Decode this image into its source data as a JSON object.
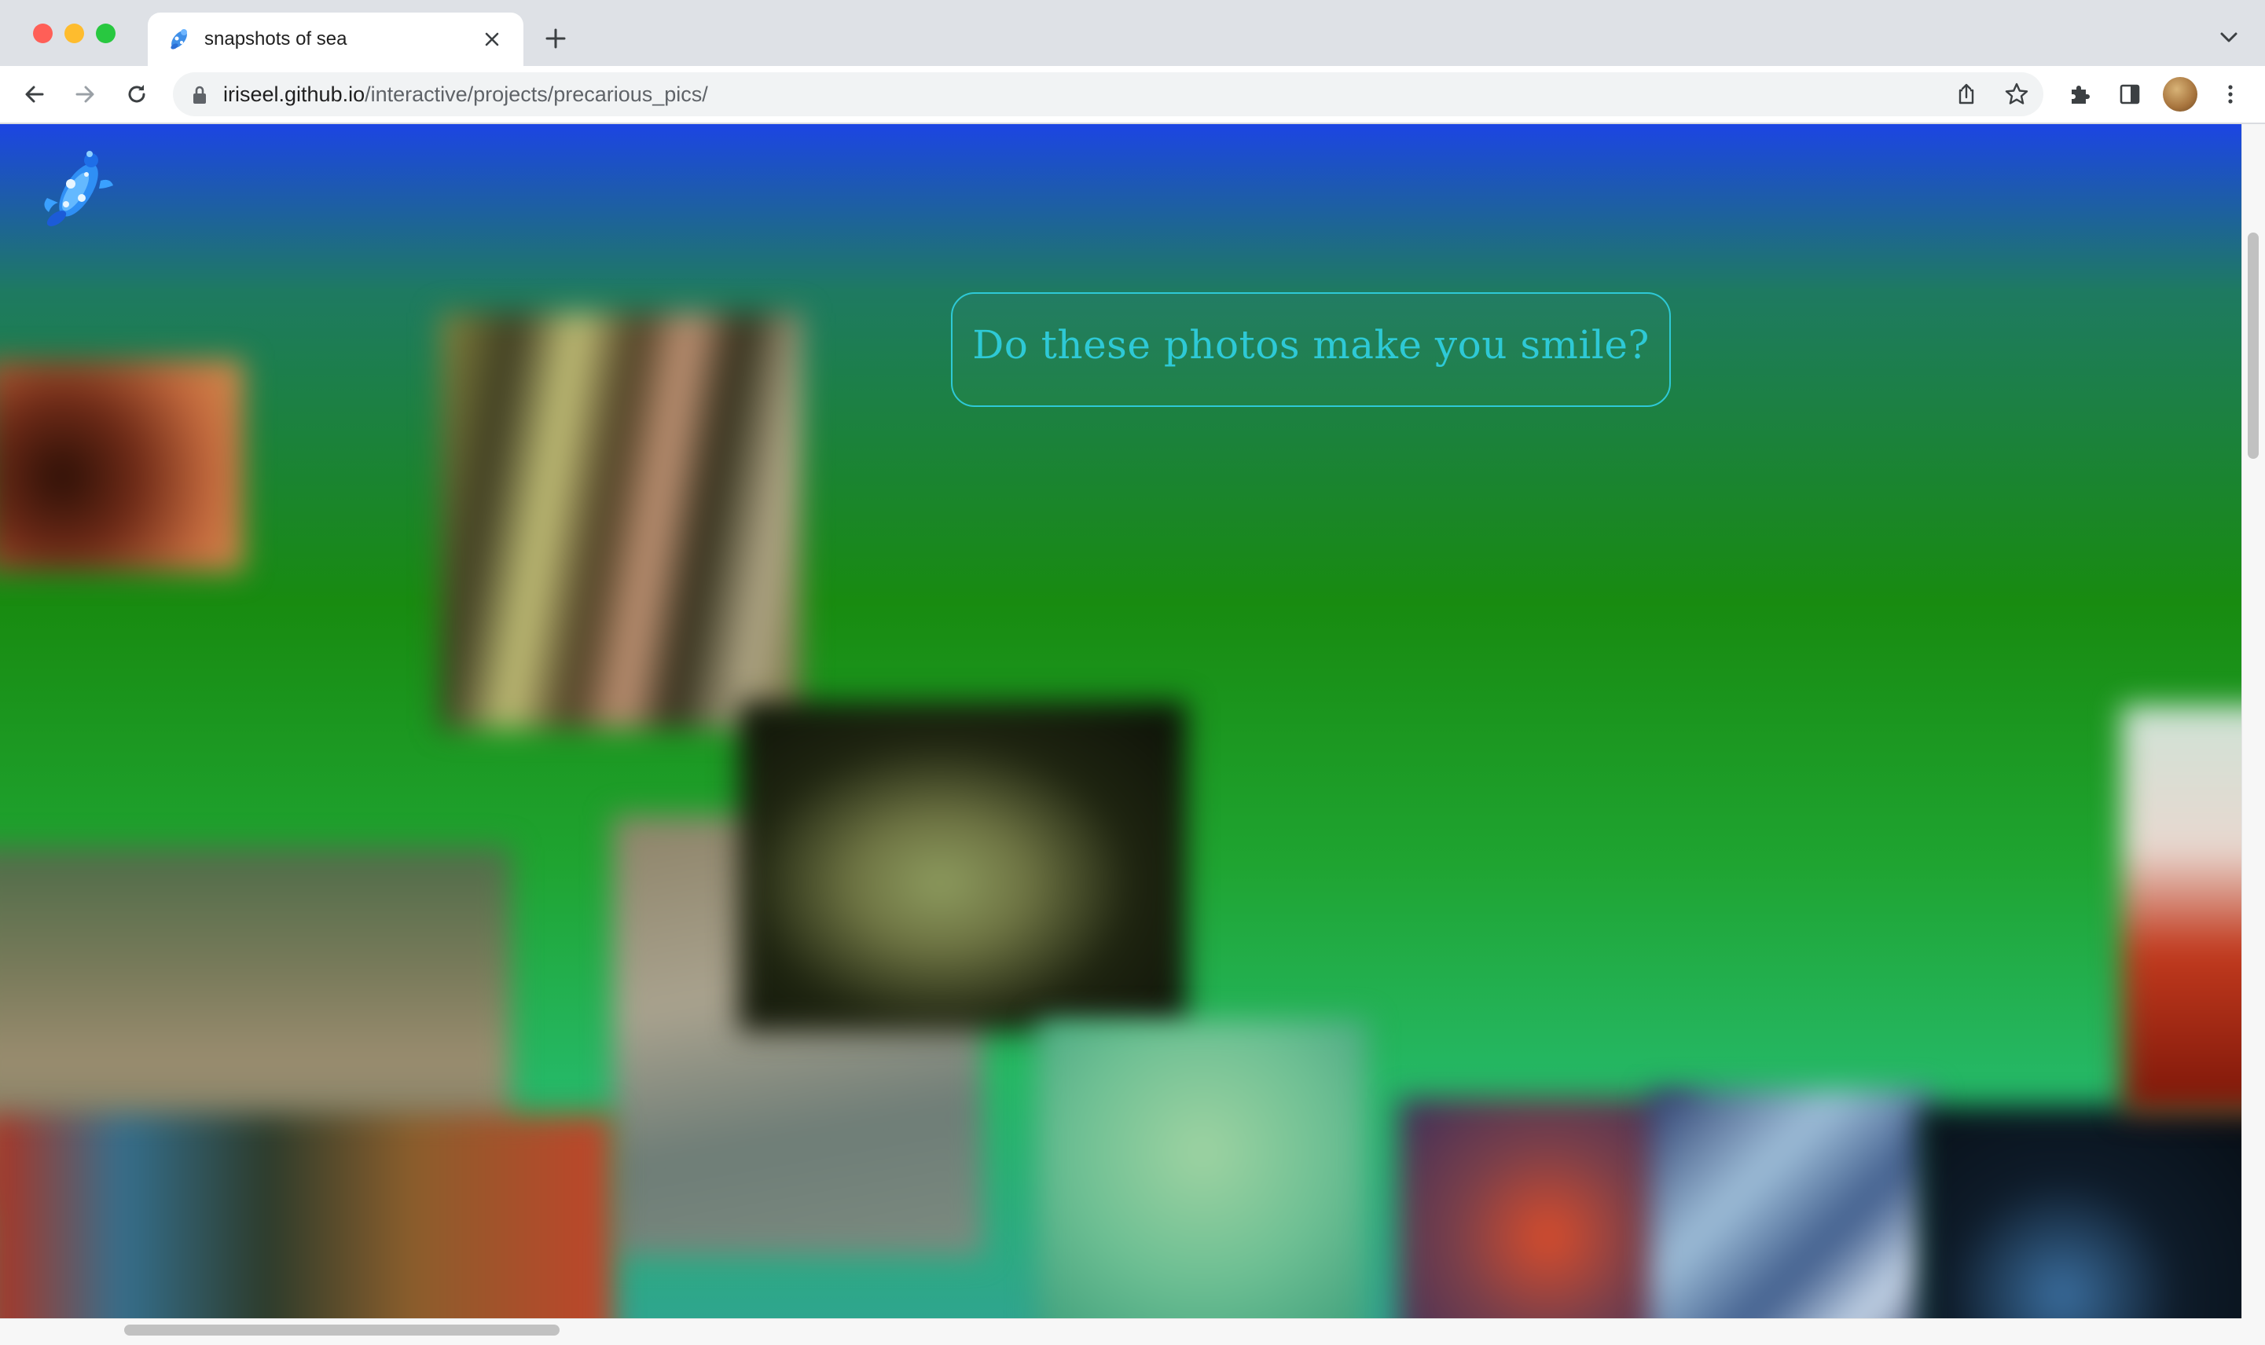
{
  "browser": {
    "tab": {
      "title": "snapshots of sea",
      "favicon": "koi-fish-icon"
    },
    "address_bar": {
      "url_host": "iriseel.github.io",
      "url_path": "/interactive/projects/precarious_pics/"
    },
    "toolbar_icons": [
      "back-icon",
      "forward-icon",
      "reload-icon",
      "lock-icon",
      "share-icon",
      "bookmark-star-icon",
      "extensions-puzzle-icon",
      "side-panel-icon",
      "profile-avatar",
      "more-menu-icon"
    ],
    "colors": {
      "tab_strip": "#dee1e6",
      "traffic_close": "#ff5f57",
      "traffic_minimize": "#febc2e",
      "traffic_maximize": "#28c840"
    }
  },
  "page": {
    "logo": "koi-fish-icon",
    "prompt_button": {
      "label": "Do these photos make you smile?"
    },
    "colors": {
      "gradient_top": "#1c45e3",
      "gradient_middle": "#188b10",
      "gradient_bottom": "#25b865",
      "accent": "#2ec9d6"
    }
  }
}
